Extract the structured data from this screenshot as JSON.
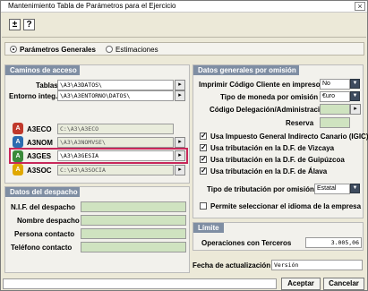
{
  "window": {
    "title": "Mantenimiento Tabla de Parámetros para el Ejercicio",
    "close": "×"
  },
  "toolbar": {
    "add": "±",
    "help": "?"
  },
  "tabs": [
    {
      "label": "Parámetros Generales",
      "selected": true
    },
    {
      "label": "Estimaciones",
      "selected": false
    }
  ],
  "caminos": {
    "header": "Caminos de acceso",
    "tablas_label": "Tablas",
    "tablas_value": "\\A3\\A3DATOS\\",
    "entorno_label": "Entorno integ.",
    "entorno_value": "\\A3\\A3ENTORNO\\DATOS\\",
    "apps": [
      {
        "name": "A3ECO",
        "path": "C:\\A3\\A3ECO",
        "color": "#c0392b",
        "icon": "A"
      },
      {
        "name": "A3NOM",
        "path": "\\A3\\A3NOMVSE\\",
        "color": "#2b6cb0",
        "icon": "A"
      },
      {
        "name": "A3GES",
        "path": "\\A3\\A3GESIA",
        "color": "#3a8a3a",
        "icon": "A"
      },
      {
        "name": "A3SOC",
        "path": "C:\\A3\\A3SOCIA",
        "color": "#e0a800",
        "icon": "A"
      }
    ],
    "browse": "▸"
  },
  "despacho": {
    "header": "Datos del despacho",
    "fields": [
      "N.I.F. del despacho",
      "Nombre despacho",
      "Persona contacto",
      "Teléfono contacto"
    ]
  },
  "generales": {
    "header": "Datos generales por omisión",
    "imprimir_label": "Imprimir Código Cliente en impresos",
    "imprimir_value": "No",
    "moneda_label": "Tipo de moneda por omisión",
    "moneda_value": "€uro",
    "delegacion_label": "Código Delegación/Administración",
    "reserva_label": "Reserva",
    "checks": [
      {
        "label": "Usa Impuesto General Indirecto Canario (IGIC)",
        "checked": true
      },
      {
        "label": "Usa tributación en la D.F. de Vizcaya",
        "checked": true
      },
      {
        "label": "Usa tributación en la D.F. de Guipúzcoa",
        "checked": true
      },
      {
        "label": "Usa tributación en la D.F. de Álava",
        "checked": true
      }
    ],
    "tributacion_label": "Tipo de tributación por omisión",
    "tributacion_value": "Estatal",
    "idioma_label": "Permite seleccionar el idioma de la empresa",
    "idioma_checked": false
  },
  "limite": {
    "header": "Límite",
    "operaciones_label": "Operaciones con Terceros",
    "operaciones_value": "3.005,06"
  },
  "actualizacion": {
    "label": "Fecha de actualización",
    "value": "Versión"
  },
  "buttons": {
    "accept": "Aceptar",
    "cancel": "Cancelar"
  },
  "colors": {
    "panel_header": "#7f8ea3",
    "highlight": "#c8285a",
    "dropdown": "#3d4b5e"
  }
}
